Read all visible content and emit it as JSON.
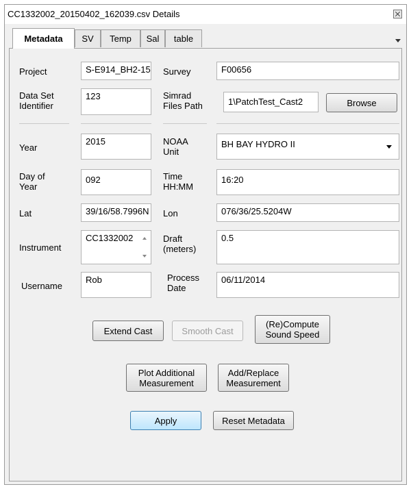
{
  "window": {
    "title": "CC1332002_20150402_162039.csv Details"
  },
  "tabs": [
    {
      "label": "Metadata",
      "active": true
    },
    {
      "label": "SV"
    },
    {
      "label": "Temp"
    },
    {
      "label": "Sal"
    },
    {
      "label": "table"
    }
  ],
  "form": {
    "project_label": "Project",
    "project_value": "S-E914_BH2-15",
    "survey_label": "Survey",
    "survey_value": "F00656",
    "dataset_label": "Data Set Identifier",
    "dataset_value": "123",
    "simrad_label": "Simrad Files Path",
    "simrad_value": "1\\PatchTest_Cast2",
    "browse_label": "Browse",
    "year_label": "Year",
    "year_value": "2015",
    "noaa_label": "NOAA Unit",
    "noaa_value": "BH BAY HYDRO II",
    "doy_label": "Day of Year",
    "doy_value": "092",
    "time_label": "Time HH:MM",
    "time_value": "16:20",
    "lat_label": "Lat",
    "lat_value": "39/16/58.7996N",
    "lon_label": "Lon",
    "lon_value": "076/36/25.5204W",
    "instrument_label": "Instrument",
    "instrument_value": "CC1332002",
    "draft_label": "Draft (meters)",
    "draft_value": "0.5",
    "username_label": "Username",
    "username_value": "Rob",
    "process_label": "Process Date",
    "process_value": "06/11/2014"
  },
  "buttons": {
    "extend_cast": "Extend Cast",
    "smooth_cast": "Smooth Cast",
    "recompute": "(Re)Compute Sound Speed",
    "plot_additional": "Plot Additional Measurement",
    "add_replace": "Add/Replace Measurement",
    "apply": "Apply",
    "reset_metadata": "Reset Metadata"
  },
  "colors": {
    "accent": "#3c7fb1",
    "disabled_text": "#9c9c9c"
  },
  "icons": [
    "close-icon",
    "tab-overflow-icon",
    "dropdown-arrow-icon",
    "spin-up-icon",
    "spin-down-icon"
  ]
}
